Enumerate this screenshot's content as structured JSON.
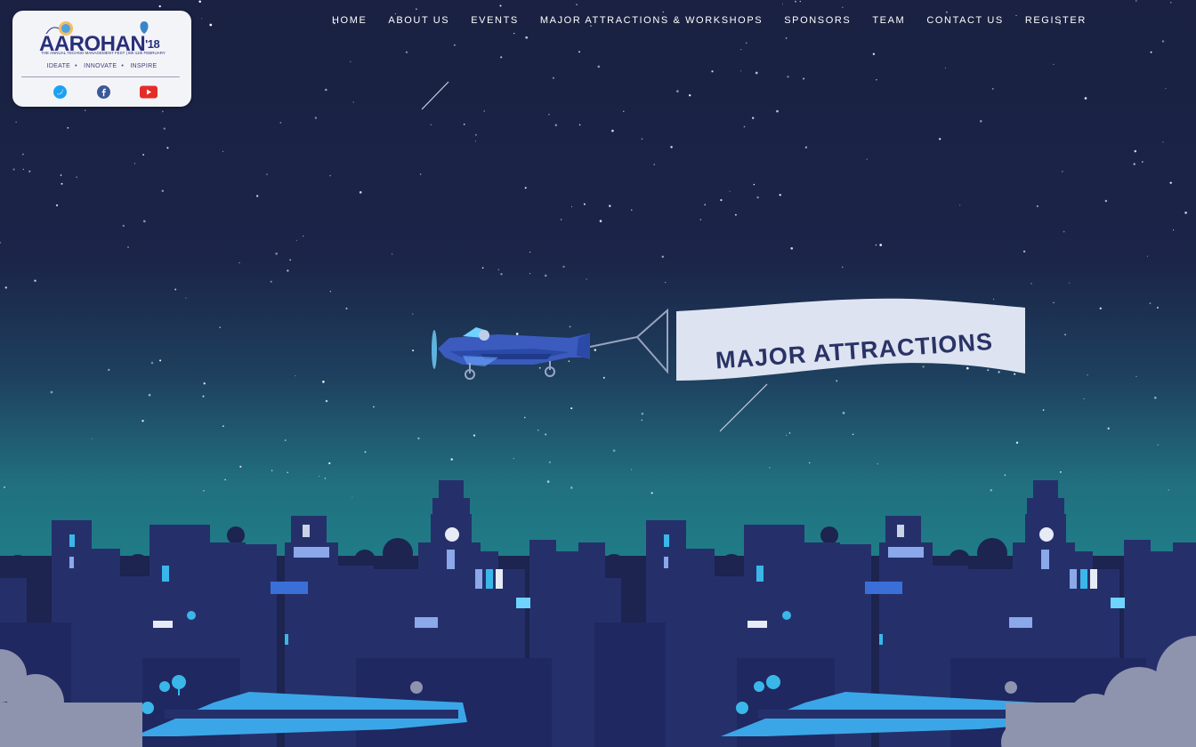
{
  "logo": {
    "title": "AAROHAN",
    "year": "'18",
    "subtitle": "THE ANNUAL TECHNO MANAGEMENT FEST | 8th-11th FEBRUARY",
    "taglines": [
      "IDEATE",
      "INNOVATE",
      "INSPIRE"
    ]
  },
  "social": [
    {
      "icon": "twitter-icon",
      "color": "#1da1f2"
    },
    {
      "icon": "facebook-icon",
      "color": "#3b5998"
    },
    {
      "icon": "youtube-icon",
      "color": "#e52d27"
    }
  ],
  "nav": [
    "HOME",
    "ABOUT US",
    "EVENTS",
    "MAJOR ATTRACTIONS & WORKSHOPS",
    "SPONSORS",
    "TEAM",
    "CONTACT US",
    "REGISTER"
  ],
  "banner": {
    "text": "MAJOR ATTRACTIONS"
  },
  "colors": {
    "sky_top": "#1b2344",
    "horizon": "#218087",
    "city": "#25306b",
    "water": "#3aa6e8",
    "banner": "#dde3f0",
    "banner_text": "#2a3366",
    "plane": "#3b5bbf"
  }
}
